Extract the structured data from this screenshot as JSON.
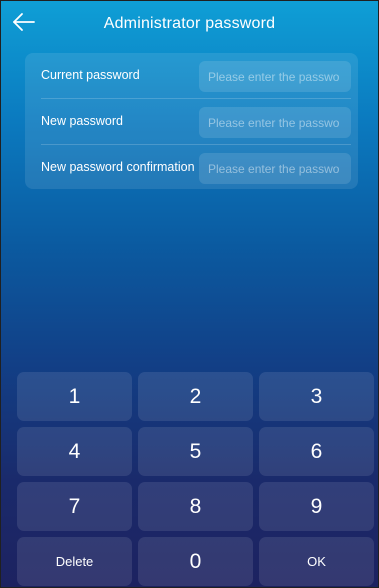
{
  "header": {
    "title": "Administrator password",
    "back_icon": "arrow-left-icon"
  },
  "form": {
    "rows": [
      {
        "label": "Current password",
        "placeholder": "Please enter the passwo",
        "value": ""
      },
      {
        "label": "New password",
        "placeholder": "Please enter the passwo",
        "value": ""
      },
      {
        "label": "New password confirmation",
        "placeholder": "Please enter the passwo",
        "value": ""
      }
    ]
  },
  "keypad": {
    "keys": [
      "1",
      "2",
      "3",
      "4",
      "5",
      "6",
      "7",
      "8",
      "9",
      "Delete",
      "0",
      "OK"
    ]
  },
  "colors": {
    "background_top": "#0f9fd6",
    "background_bottom": "#1d2260",
    "text": "#ffffff"
  }
}
